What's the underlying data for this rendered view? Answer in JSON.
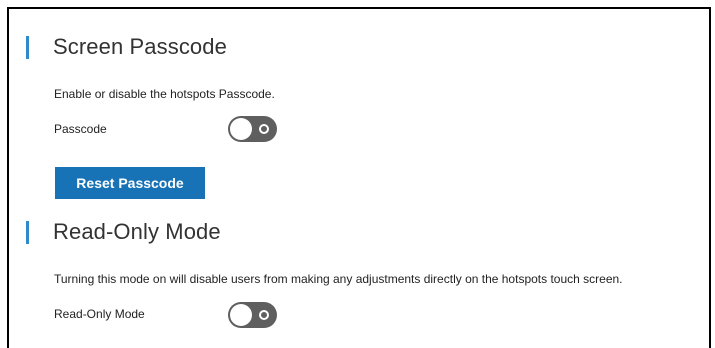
{
  "passcode_section": {
    "title": "Screen Passcode",
    "description": "Enable or disable the hotspots Passcode.",
    "toggle_label": "Passcode",
    "toggle_state": "off",
    "reset_button_label": "Reset Passcode"
  },
  "readonly_section": {
    "title": "Read-Only Mode",
    "description": "Turning this mode on will disable users from making any adjustments directly on the hotspots touch screen.",
    "toggle_label": "Read-Only Mode",
    "toggle_state": "off"
  },
  "colors": {
    "accent_bar": "#2e8bc9",
    "button": "#1873b6",
    "toggle_off": "#5f5f5f"
  }
}
